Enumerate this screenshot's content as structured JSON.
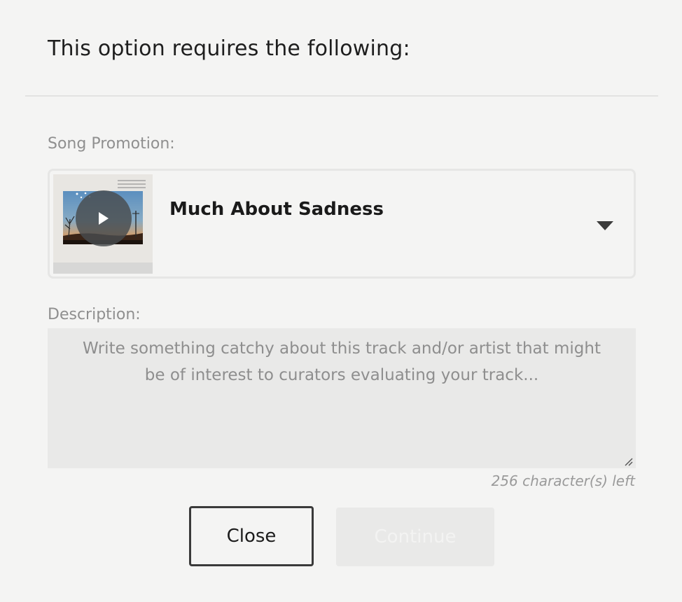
{
  "modal": {
    "title": "This option requires the following:"
  },
  "song_promotion": {
    "label": "Song Promotion:",
    "selected_song": "Much About Sadness",
    "cover_icon": "album-cover-image",
    "play_icon": "play-icon",
    "dropdown_icon": "caret-down-icon"
  },
  "description": {
    "label": "Description:",
    "placeholder": "Write something catchy about this track and/or artist that might be of interest to curators evaluating your track...",
    "value": "",
    "counter": "256 character(s) left"
  },
  "actions": {
    "close_label": "Close",
    "continue_label": "Continue"
  },
  "colors": {
    "background": "#f4f4f3",
    "field_background": "#e9e9e8",
    "disabled_button": "#e9e9e8",
    "text_primary": "#1c1c1c",
    "text_muted": "#8f8f8f"
  }
}
